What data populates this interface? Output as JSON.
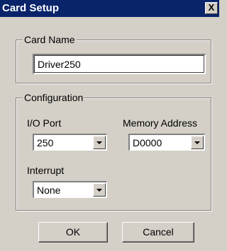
{
  "window": {
    "title": "Card Setup",
    "close_glyph": "X"
  },
  "card_name_group": {
    "legend": "Card Name",
    "value": "Driver250"
  },
  "configuration_group": {
    "legend": "Configuration",
    "io_port": {
      "label": "I/O Port",
      "selected": "250"
    },
    "memory_address": {
      "label": "Memory Address",
      "selected": "D0000"
    },
    "interrupt": {
      "label": "Interrupt",
      "selected": "None"
    }
  },
  "buttons": {
    "ok": "OK",
    "cancel": "Cancel"
  },
  "icons": {
    "close": "close-icon",
    "dropdown": "chevron-down-icon"
  }
}
